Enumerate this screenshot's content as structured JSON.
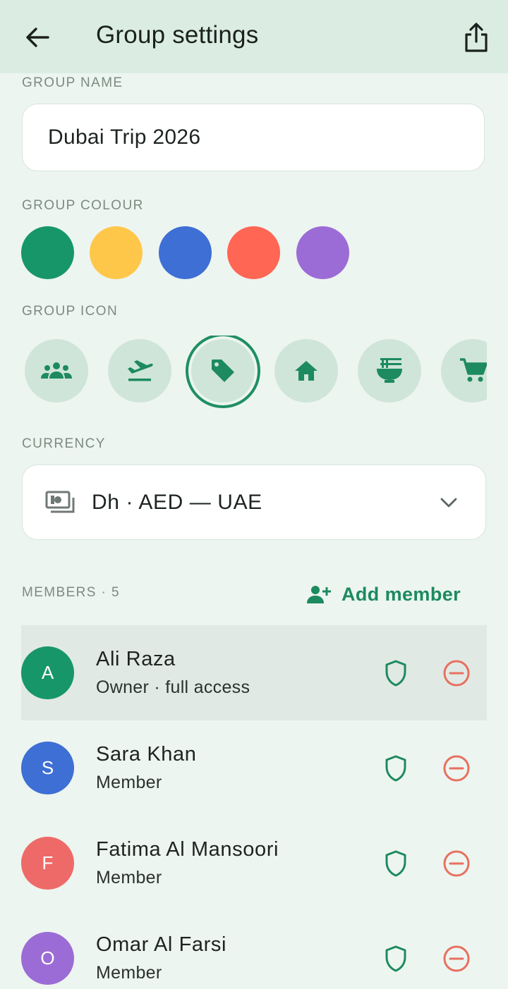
{
  "header": {
    "title": "Group settings",
    "back_icon": "arrow-left-icon",
    "share_icon": "share-icon"
  },
  "group_name": {
    "label": "GROUP NAME",
    "value": "Dubai Trip 2026"
  },
  "group_colour": {
    "label": "GROUP COLOUR",
    "options": [
      "#17966a",
      "#ffc74a",
      "#3d6fd4",
      "#ff6654",
      "#9c6cd6"
    ]
  },
  "group_icon": {
    "label": "GROUP ICON",
    "options": [
      "people-group-icon",
      "flight-departure-icon",
      "tag-icon",
      "home-icon",
      "food-bowl-icon",
      "shopping-cart-icon"
    ],
    "selected": "tag-icon"
  },
  "currency": {
    "label": "CURRENCY",
    "value": "Dh · AED — UAE",
    "icon": "money-icon",
    "dropdown_icon": "chevron-down-icon"
  },
  "members": {
    "label": "MEMBERS · 5",
    "add_label": "Add member",
    "items": [
      {
        "initial": "A",
        "name": "Ali Raza",
        "role": "Owner · full access",
        "color": "#17966a"
      },
      {
        "initial": "S",
        "name": "Sara Khan",
        "role": "Member",
        "color": "#3d6fd4"
      },
      {
        "initial": "F",
        "name": "Fatima Al Mansoori",
        "role": "Member",
        "color": "#ee6a68"
      },
      {
        "initial": "O",
        "name": "Omar Al Farsi",
        "role": "Member",
        "color": "#9c6cd6"
      }
    ]
  },
  "colors": {
    "accent": "#1d8a5f",
    "danger": "#e8705f",
    "background": "#edf5f0",
    "appbar": "#dbede3"
  }
}
